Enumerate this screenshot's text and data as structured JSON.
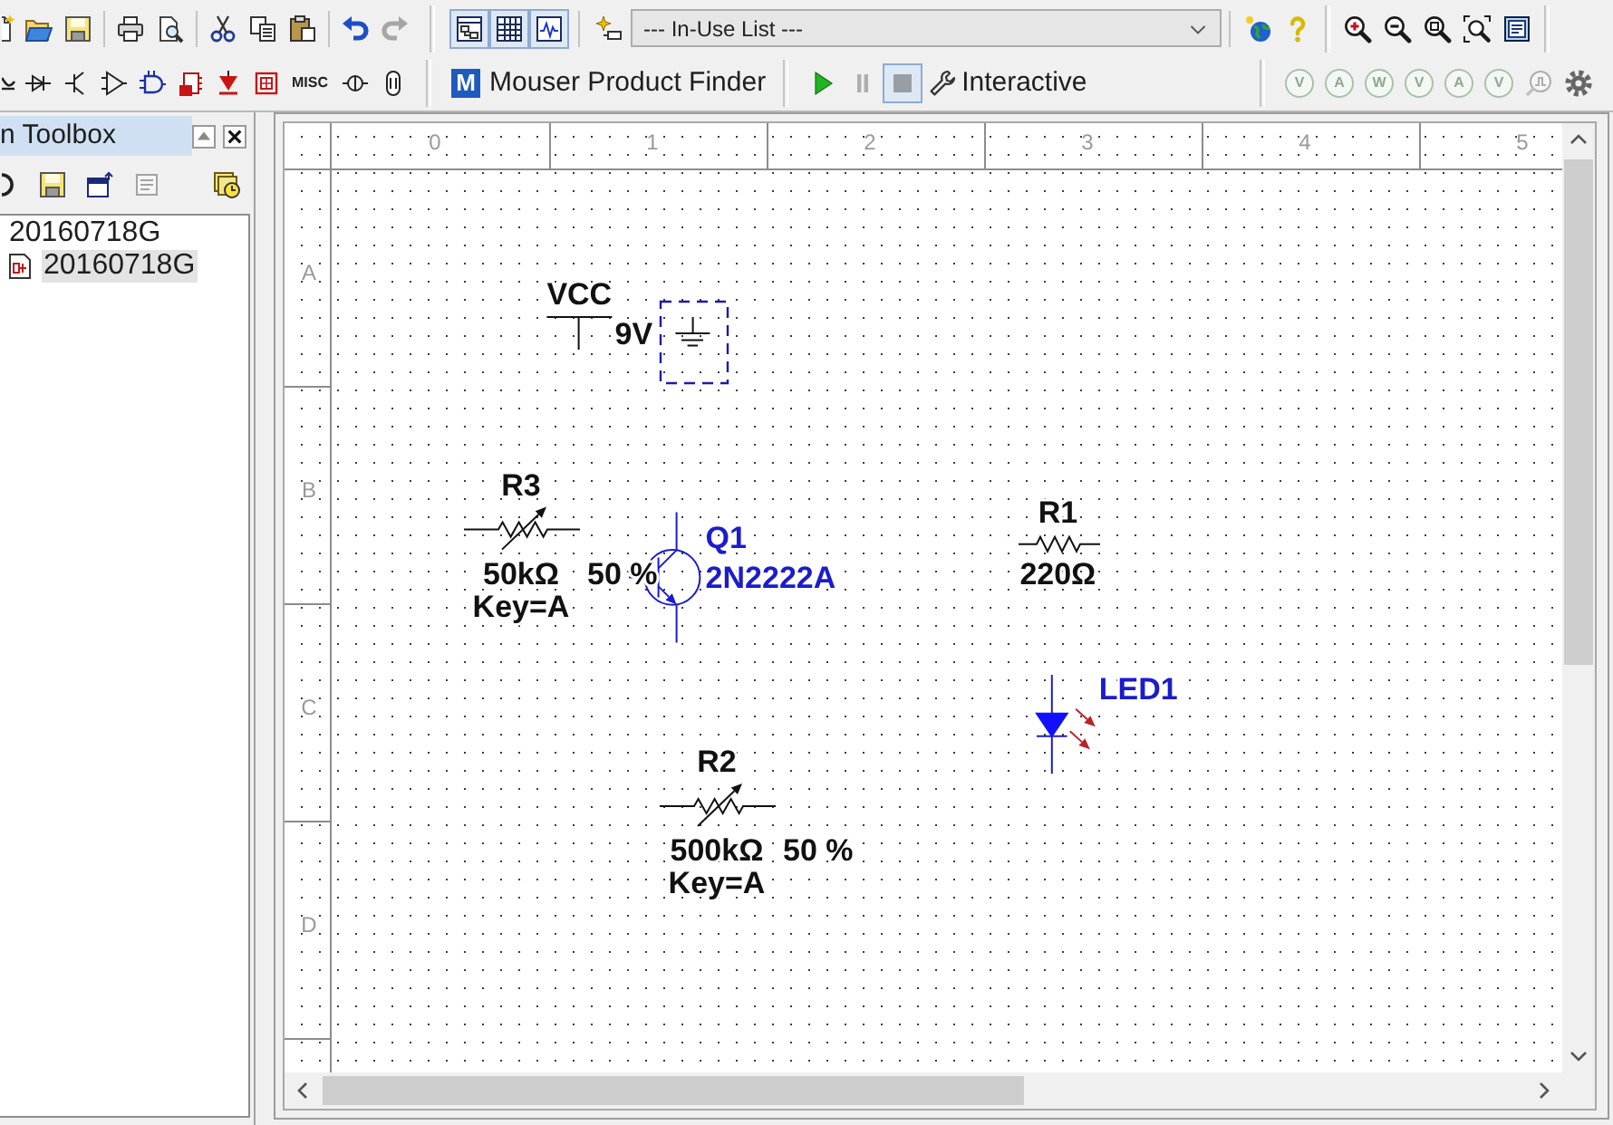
{
  "standard_toolbar": [
    [
      {
        "kind": "new",
        "disabled": false
      },
      {
        "kind": "open",
        "disabled": false
      },
      {
        "kind": "save",
        "disabled": false
      }
    ],
    [
      {
        "kind": "print",
        "disabled": false
      },
      {
        "kind": "preview",
        "disabled": false
      }
    ],
    [
      {
        "kind": "cut",
        "disabled": false
      },
      {
        "kind": "copy",
        "disabled": false
      },
      {
        "kind": "paste",
        "disabled": false
      }
    ],
    [
      {
        "kind": "undo",
        "disabled": false
      },
      {
        "kind": "redo",
        "disabled": true
      }
    ]
  ],
  "view_toolbar": [
    {
      "kind": "hierarchy",
      "pressed": true
    },
    {
      "kind": "spreadsheet",
      "pressed": true
    },
    {
      "kind": "grapher",
      "pressed": true
    }
  ],
  "in_use_list": {
    "value": "--- In-Use List ---"
  },
  "parts_toolbar": {
    "misc_button": "MISC"
  },
  "mouser_button": {
    "logo": "M",
    "label": "Mouser Product Finder"
  },
  "simulation_toolbar": {
    "buttons": [
      {
        "kind": "run",
        "disabled": false,
        "pressed": false
      },
      {
        "kind": "pause",
        "disabled": true,
        "pressed": false
      },
      {
        "kind": "stop",
        "disabled": true,
        "pressed": true
      }
    ],
    "mode": "Interactive"
  },
  "probes_toolbar": [
    {
      "kind": "probe",
      "label": "V",
      "disabled": true
    },
    {
      "kind": "probe",
      "label": "A",
      "disabled": true
    },
    {
      "kind": "probe",
      "label": "W",
      "disabled": true
    },
    {
      "kind": "probe",
      "label": "V",
      "disabled": true
    },
    {
      "kind": "probe",
      "label": "A",
      "disabled": true
    },
    {
      "kind": "probe",
      "label": "V",
      "disabled": true
    },
    {
      "kind": "digital",
      "disabled": true
    },
    {
      "kind": "settings",
      "disabled": false
    }
  ],
  "design_toolbox": {
    "title": "n Toolbox",
    "tools": [
      {
        "kind": "refresh",
        "disabled": false
      },
      {
        "kind": "save",
        "disabled": false
      },
      {
        "kind": "window",
        "disabled": false
      },
      {
        "kind": "text",
        "disabled": true
      },
      {
        "kind": "history",
        "disabled": false
      }
    ],
    "tree": [
      {
        "label": "20160718G",
        "selected": false,
        "children": [
          {
            "label": "20160718G",
            "selected": true
          }
        ]
      }
    ]
  },
  "schematic": {
    "column_labels": [
      "0",
      "1",
      "2",
      "3",
      "4",
      "5"
    ],
    "row_labels": [
      "A",
      "B",
      "C",
      "D"
    ],
    "components": [
      {
        "kind": "vcc",
        "label": "VCC",
        "value": "9V",
        "selected": false
      },
      {
        "kind": "ground",
        "selected": true
      },
      {
        "kind": "potentiometer",
        "label": "R3",
        "value": "50kΩ",
        "setting": "50 %",
        "key": "Key=A",
        "selected": false
      },
      {
        "kind": "transistor",
        "label": "Q1",
        "value": "2N2222A",
        "selected": false
      },
      {
        "kind": "resistor",
        "label": "R1",
        "value": "220Ω",
        "selected": false
      },
      {
        "kind": "led",
        "label": "LED1",
        "selected": false
      },
      {
        "kind": "potentiometer",
        "label": "R2",
        "value": "500kΩ",
        "setting": "50 %",
        "key": "Key=A",
        "selected": false
      }
    ]
  }
}
